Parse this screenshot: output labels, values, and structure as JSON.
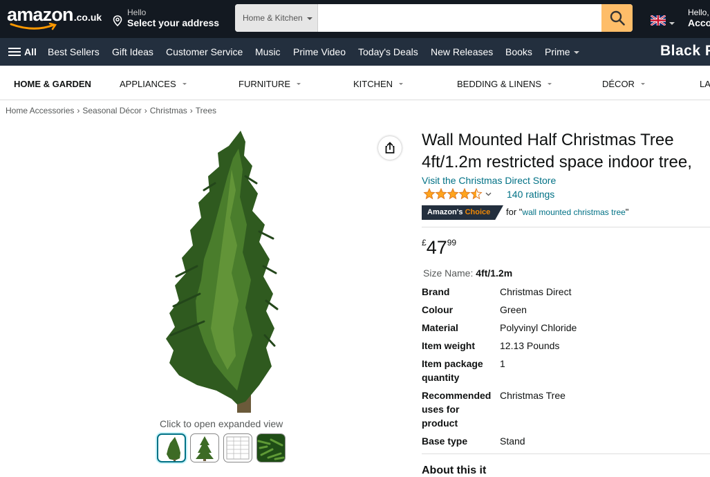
{
  "header": {
    "logo_text": "amazon",
    "logo_tld": ".co.uk",
    "deliver_line1": "Hello",
    "deliver_line2": "Select your address",
    "search_category": "Home & Kitchen",
    "search_placeholder": "",
    "account_line1": "Hello,",
    "account_line2": "Acco"
  },
  "nav": {
    "all_label": "All",
    "items": [
      "Best Sellers",
      "Gift Ideas",
      "Customer Service",
      "Music",
      "Prime Video",
      "Today's Deals",
      "New Releases",
      "Books",
      "Prime"
    ],
    "promo": "Black F"
  },
  "category_bar": {
    "home": "HOME & GARDEN",
    "items": [
      "APPLIANCES",
      "FURNITURE",
      "KITCHEN",
      "BEDDING & LINENS",
      "DÉCOR",
      "LA"
    ]
  },
  "breadcrumb": [
    "Home Accessories",
    "Seasonal Décor",
    "Christmas",
    "Trees"
  ],
  "breadcrumb_sep": "›",
  "gallery": {
    "expand_hint": "Click to open expanded view",
    "thumbnail_count": 4,
    "selected_index": 0
  },
  "product": {
    "title_line1": "Wall Mounted Half Christmas Tree",
    "title_line2": "4ft/1.2m restricted space indoor tree,",
    "store_link": "Visit the Christmas Direct Store",
    "rating_value": 4.5,
    "ratings_count": "140 ratings",
    "choice_badge_a": "Amazon's",
    "choice_badge_b": "Choice",
    "choice_for": "for \"",
    "choice_keyword": "wall mounted christmas tree",
    "choice_end": "\"",
    "price_symbol": "£",
    "price_whole": "47",
    "price_fraction": "99",
    "size_label": "Size Name:",
    "size_value": "4ft/1.2m",
    "specs": [
      {
        "key": "Brand",
        "value": "Christmas Direct"
      },
      {
        "key": "Colour",
        "value": "Green"
      },
      {
        "key": "Material",
        "value": "Polyvinyl Chloride"
      },
      {
        "key": "Item weight",
        "value": "12.13 Pounds"
      },
      {
        "key": "Item package quantity",
        "value": "1"
      },
      {
        "key": "Recommended uses for product",
        "value": "Christmas Tree"
      },
      {
        "key": "Base type",
        "value": "Stand"
      }
    ],
    "about_heading": "About this it"
  },
  "colors": {
    "nav_dark": "#131921",
    "nav_secondary": "#232f3e",
    "search_button": "#febd69",
    "link": "#007185",
    "star": "#ffa41c",
    "choice_orange": "#f08804"
  },
  "icons": [
    "location-pin-icon",
    "search-icon",
    "uk-flag-icon",
    "hamburger-icon",
    "share-icon",
    "star-icon",
    "chevron-down-icon"
  ]
}
